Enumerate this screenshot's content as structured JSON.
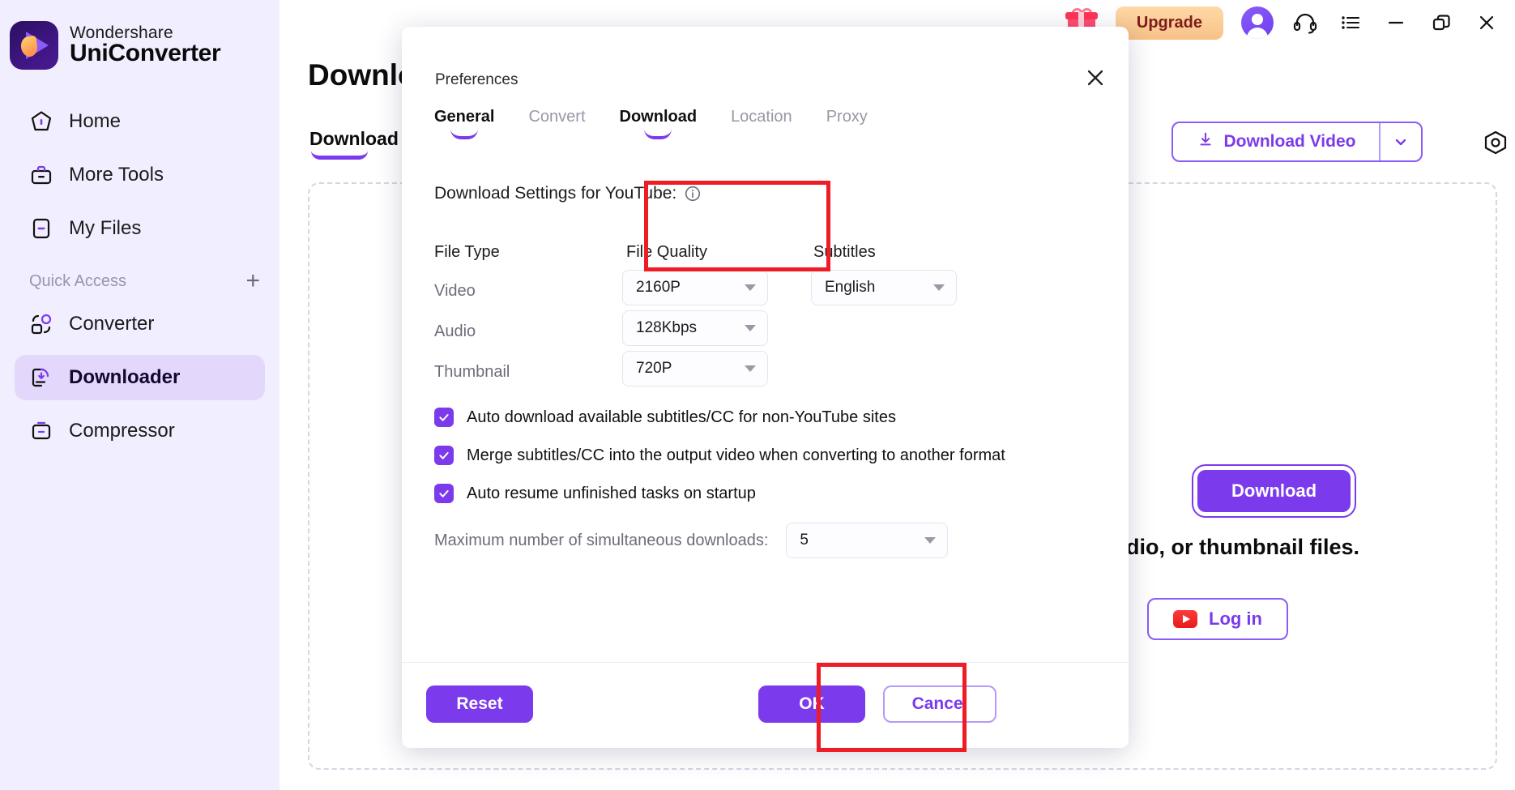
{
  "app": {
    "brand_top": "Wondershare",
    "brand_bottom": "UniConverter"
  },
  "sidebar": {
    "items": [
      {
        "label": "Home",
        "icon": "home-icon",
        "active": false
      },
      {
        "label": "More Tools",
        "icon": "toolbox-icon",
        "active": false
      },
      {
        "label": "My Files",
        "icon": "files-icon",
        "active": false
      }
    ],
    "quick_access": {
      "label": "Quick Access",
      "add_icon": "plus-icon"
    },
    "quick_items": [
      {
        "label": "Converter",
        "icon": "converter-icon",
        "active": false
      },
      {
        "label": "Downloader",
        "icon": "downloader-icon",
        "active": true
      },
      {
        "label": "Compressor",
        "icon": "compressor-icon",
        "active": false
      }
    ]
  },
  "topbar": {
    "gift_icon": "gift-icon",
    "upgrade_label": "Upgrade",
    "avatar_icon": "user-avatar-icon",
    "headset_icon": "headset-icon",
    "menu_icon": "list-menu-icon",
    "minimize_icon": "minimize-icon",
    "maximize_icon": "restore-window-icon",
    "close_icon": "close-window-icon"
  },
  "main": {
    "page_title": "Download",
    "sub_tab": "Download",
    "download_video_label": "Download Video",
    "download_video_icon": "download-arrow-icon",
    "download_video_caret": "chevron-down-icon",
    "settings_gear_icon": "hex-gear-icon",
    "download_button_label": "Download",
    "hint_text": "dio, or thumbnail files.",
    "login_label": "Log in",
    "login_icon": "youtube-icon"
  },
  "dialog": {
    "title": "Preferences",
    "close_icon": "close-icon",
    "tabs": [
      {
        "label": "General",
        "active": true
      },
      {
        "label": "Convert",
        "active": false
      },
      {
        "label": "Download",
        "active": true
      },
      {
        "label": "Location",
        "active": false
      },
      {
        "label": "Proxy",
        "active": false
      }
    ],
    "section_heading": "Download Settings for YouTube:",
    "info_icon": "info-icon",
    "columns": {
      "file_type": "File Type",
      "file_quality": "File Quality",
      "subtitles": "Subtitles"
    },
    "rows": [
      {
        "type": "Video",
        "quality": "2160P"
      },
      {
        "type": "Audio",
        "quality": "128Kbps"
      },
      {
        "type": "Thumbnail",
        "quality": "720P"
      }
    ],
    "subtitle_value": "English",
    "checkboxes": [
      {
        "label": "Auto download available subtitles/CC for non-YouTube sites",
        "checked": true
      },
      {
        "label": "Merge subtitles/CC into the output video when converting to another format",
        "checked": true
      },
      {
        "label": "Auto resume unfinished tasks on startup",
        "checked": true
      }
    ],
    "max_downloads": {
      "label": "Maximum number of simultaneous downloads:",
      "value": "5"
    },
    "footer": {
      "reset_label": "Reset",
      "ok_label": "OK",
      "cancel_label": "Cancel"
    }
  },
  "annotations": {
    "highlight_color": "#EE1C25",
    "boxes": [
      {
        "name": "file-quality-highlight"
      },
      {
        "name": "ok-button-highlight"
      }
    ]
  },
  "colors": {
    "accent": "#7C3AED",
    "sidebar_bg": "#F1EEFF",
    "active_item_bg": "#E3D7FB",
    "upgrade_bg": "#F8C188",
    "highlight_red": "#EE1C25"
  }
}
